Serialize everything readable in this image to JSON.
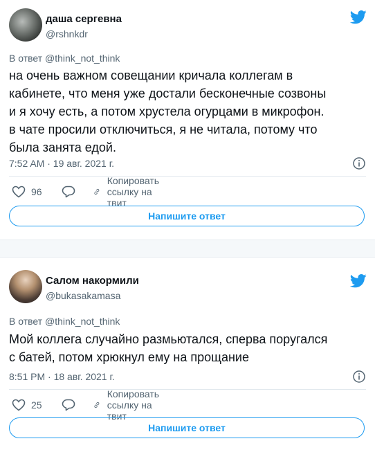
{
  "colors": {
    "accent": "#1d9bf0",
    "text": "#0f1419",
    "muted": "#536471",
    "border": "#e1e8ed"
  },
  "tweets": [
    {
      "display_name": "даша сергевна",
      "handle": "@rshnkdr",
      "reply_to": "В ответ @think_not_think",
      "text_lines": [
        "на очень важном совещании кричала коллегам в",
        "кабинете, что меня уже достали бесконечные созвоны",
        "и я хочу есть, а потом хрустела огурцами в микрофон.",
        "в чате просили отключиться, я не читала, потому что",
        "была занята едой."
      ],
      "timestamp": "7:52 AM · 19 авг. 2021 г.",
      "likes": "96",
      "copy_link_label": "Копировать ссылку на твит",
      "reply_button_label": "Напишите ответ"
    },
    {
      "display_name": "Салом накормили",
      "handle": "@bukasakamasa",
      "reply_to": "В ответ @think_not_think",
      "text_lines": [
        "Мой коллега случайно размьютался, сперва поругался",
        "с батей, потом хрюкнул ему на прощание"
      ],
      "timestamp": "8:51 PM · 18 авг. 2021 г.",
      "likes": "25",
      "copy_link_label": "Копировать ссылку на твит",
      "reply_button_label": "Напишите ответ"
    }
  ],
  "icons": [
    "twitter-bird-icon",
    "info-icon",
    "heart-icon",
    "reply-icon",
    "link-icon"
  ]
}
